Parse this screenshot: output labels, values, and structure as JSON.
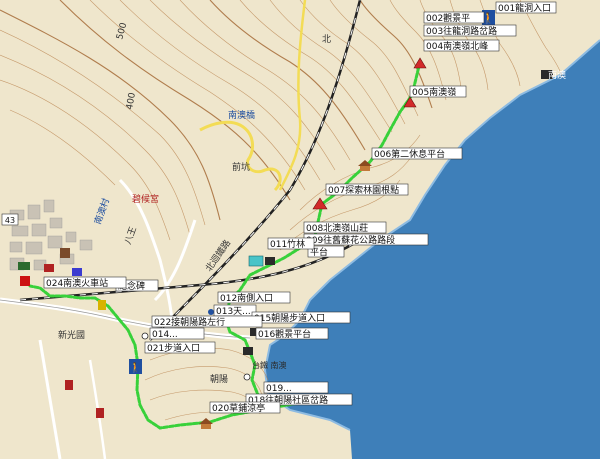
{
  "waypoints": [
    {
      "id": "001",
      "label": "001龍洞入口"
    },
    {
      "id": "002",
      "label": "002觀景平"
    },
    {
      "id": "003",
      "label": "003往龍洞路岔路"
    },
    {
      "id": "004",
      "label": "004南澳嶺北峰"
    },
    {
      "id": "005",
      "label": "005南澳嶺"
    },
    {
      "id": "006",
      "label": "006第二休息平台"
    },
    {
      "id": "007",
      "label": "007探索林園根點"
    },
    {
      "id": "008",
      "label": "008北澳嶺山莊"
    },
    {
      "id": "009",
      "label": "009往舊蘇花公路路段"
    },
    {
      "id": "010",
      "label": "平台"
    },
    {
      "id": "011",
      "label": "011竹林"
    },
    {
      "id": "012",
      "label": "012南側入口"
    },
    {
      "id": "013",
      "label": "013天..."
    },
    {
      "id": "014",
      "label": "014..."
    },
    {
      "id": "015",
      "label": "015朝陽步道入口"
    },
    {
      "id": "016",
      "label": "016觀景平台"
    },
    {
      "id": "018",
      "label": "018往朝陽社區岔路"
    },
    {
      "id": "019",
      "label": "019..."
    },
    {
      "id": "020",
      "label": "020草鋪涼亭"
    },
    {
      "id": "021",
      "label": "021步道入口"
    },
    {
      "id": "022",
      "label": "022接朝陽路左行"
    },
    {
      "id": "023",
      "label": "紀念碑"
    },
    {
      "id": "024",
      "label": "024南澳火車站"
    }
  ],
  "map_labels": {
    "elev_500": "500",
    "elev_400": "400",
    "place_nanao_bridge": "南澳橋",
    "place_nanao_village": "南澳村",
    "place_temple": "碧候宮",
    "place_front": "前坑",
    "place_road_north": "北",
    "place_eight_king": "八王",
    "place_xinguang": "新光國",
    "place_chaoyang": "朝陽",
    "place_nanao_shore": "南澳",
    "rail_name": "北迴鐵路",
    "badge_43": "43",
    "tr_tag": "台鐵 南澳"
  },
  "colors": {
    "land": "#efe6cc",
    "sea": "#3e7fb9",
    "track": "#38d13a",
    "contour": "#b77f4a",
    "road_yellow": "#f3dc55",
    "road_white": "#ffffff",
    "rail": "#222222"
  }
}
